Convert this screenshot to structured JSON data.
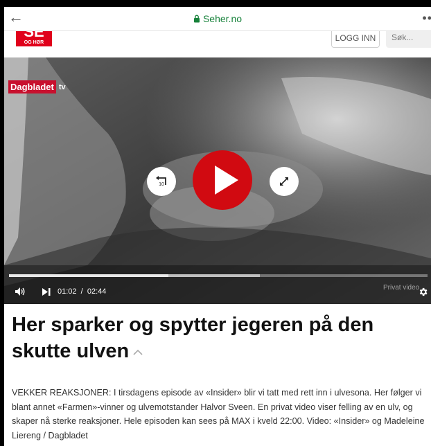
{
  "browser": {
    "url": "Seher.no",
    "icons": {
      "back": "arrow-left-icon",
      "lock": "lock-icon",
      "menu": "more-dots-icon"
    }
  },
  "site": {
    "logo_main": "SE",
    "logo_sub": "OG HØR",
    "login_label": "LOGG INN",
    "search_placeholder": "Søk..."
  },
  "video": {
    "brand": "Dagbladet",
    "brand_suffix": "tv",
    "current_time": "01:02",
    "separator": "/",
    "duration": "02:44",
    "progress": 0.38,
    "buffered": 0.6,
    "overlay_text": "Privat video",
    "colors": {
      "play": "#d10a11",
      "brand": "#c8102e"
    },
    "icons": [
      "rewind-10-icon",
      "play-icon",
      "fullscreen-icon",
      "volume-icon",
      "next-icon",
      "settings-gear-icon"
    ]
  },
  "article": {
    "title": "Her sparker og spytter jegeren på den skutte ulven",
    "description": "VEKKER REAKSJONER: I tirsdagens episode av «Insider» blir vi tatt med rett inn i ulvesona. Her følger vi blant annet «Farmen»-vinner og ulvemotstander Halvor Sveen. En privat video viser felling av en ulv, og skaper nå sterke reaksjoner. Hele episoden kan sees på MAX i kveld 22:00. Video: «Insider» og Madeleine Liereng / Dagbladet"
  }
}
